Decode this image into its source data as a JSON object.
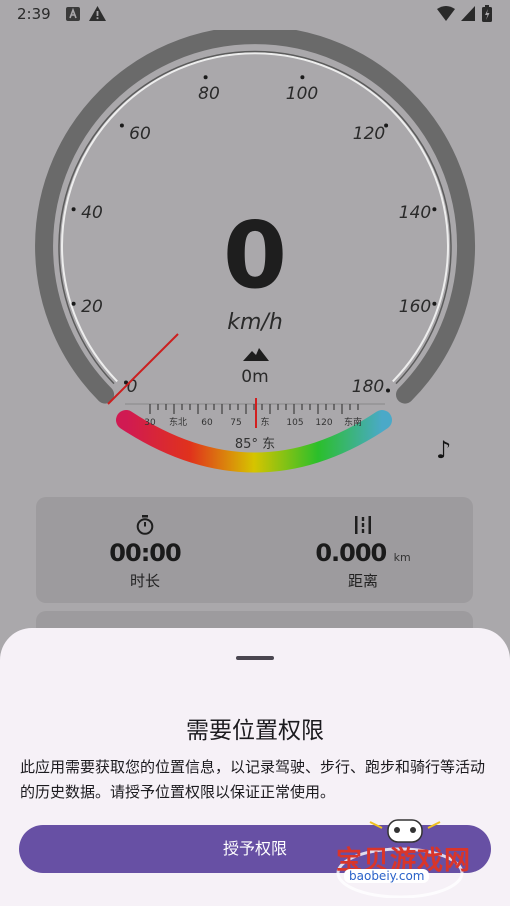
{
  "status": {
    "time": "2:39"
  },
  "gauge": {
    "speed": "0",
    "unit": "km/h",
    "altitude": "0m",
    "tick_labels": [
      "0",
      "20",
      "40",
      "60",
      "80",
      "100",
      "120",
      "140",
      "160",
      "180"
    ],
    "compass_labels": [
      "30",
      "东北",
      "60",
      "75",
      "东",
      "105",
      "120",
      "东南"
    ],
    "heading": "85° 东"
  },
  "stats": {
    "duration_value": "00:00",
    "duration_label": "时长",
    "distance_value": "0.000",
    "distance_unit": "km",
    "distance_label": "距离"
  },
  "sheet": {
    "title": "需要位置权限",
    "body": "此应用需要获取您的位置信息，以记录驾驶、步行、跑步和骑行等活动的历史数据。请授予位置权限以保证正常使用。",
    "button": "授予权限"
  },
  "watermark": {
    "text": "宝贝游戏网",
    "url": "baobeiy.com"
  }
}
